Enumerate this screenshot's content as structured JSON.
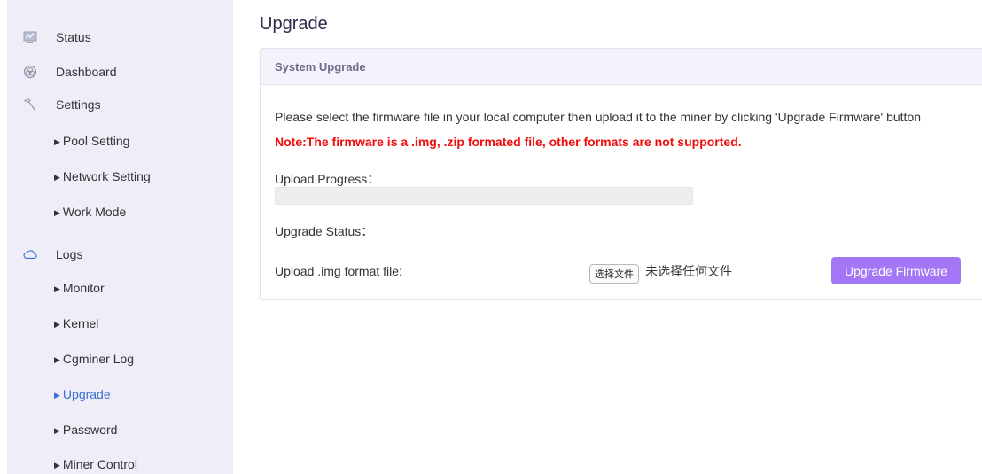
{
  "sidebar": {
    "status": "Status",
    "dashboard": "Dashboard",
    "settings": "Settings",
    "pool_setting": "Pool Setting",
    "network_setting": "Network Setting",
    "work_mode": "Work Mode",
    "logs": "Logs",
    "monitor": "Monitor",
    "kernel": "Kernel",
    "cgminer_log": "Cgminer Log",
    "upgrade": "Upgrade",
    "password": "Password",
    "miner_control": "Miner Control",
    "active_item": "Upgrade",
    "active_color": "#3b6fd1"
  },
  "page": {
    "title": "Upgrade"
  },
  "panel": {
    "heading": "System Upgrade",
    "instructions": "Please select the firmware file in your local computer then upload it to the miner by clicking 'Upgrade Firmware' button",
    "note": "Note:The firmware is a .img, .zip formated file, other formats are not supported.",
    "upload_progress_label": "Upload Progress：",
    "upload_progress_value": 0,
    "upgrade_status_label": "Upgrade Status：",
    "upload_file_label": "Upload .img format file:",
    "choose_file_button": "选择文件",
    "no_file_text": "未选择任何文件",
    "upgrade_button": "Upgrade Firmware"
  },
  "colors": {
    "accent_button": "#a376f5",
    "note_red": "#f10c0c",
    "sidebar_bg": "#eeedf8"
  }
}
